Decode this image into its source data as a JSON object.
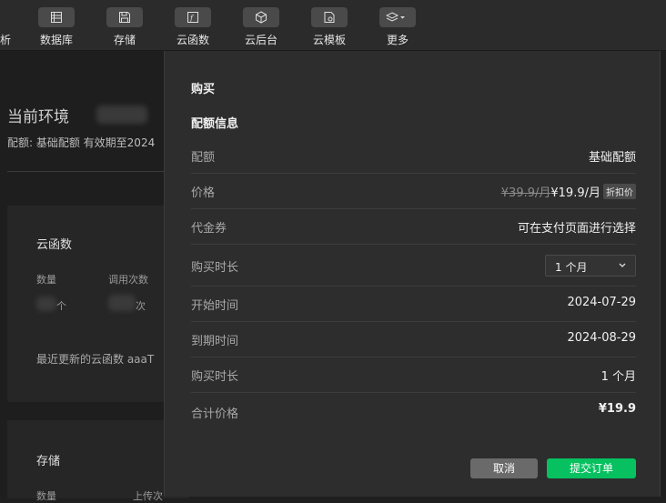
{
  "toolbar": {
    "partial_label": "析",
    "items": [
      {
        "label": "数据库",
        "icon": "database-icon"
      },
      {
        "label": "存储",
        "icon": "save-icon"
      },
      {
        "label": "云函数",
        "icon": "function-icon"
      },
      {
        "label": "云后台",
        "icon": "cube-icon"
      },
      {
        "label": "云模板",
        "icon": "template-icon"
      },
      {
        "label": "更多",
        "icon": "layers-icon"
      }
    ]
  },
  "background": {
    "env_title": "当前环境",
    "env_quota": "配额: 基础配额  有效期至2024",
    "functions_card": {
      "title": "云函数",
      "count_label": "数量",
      "calls_label": "调用次数",
      "count_unit": "个",
      "calls_unit": "次",
      "recent_text": "最近更新的云函数  aaaT"
    },
    "storage_card": {
      "title": "存储",
      "count_label": "数量",
      "upload_label": "上传次"
    }
  },
  "modal": {
    "title": "购买",
    "section": "配额信息",
    "rows": {
      "quota": {
        "label": "配额",
        "value": "基础配额"
      },
      "price": {
        "label": "价格",
        "original": "¥39.9/月",
        "current": "¥19.9/月",
        "badge": "折扣价"
      },
      "voucher": {
        "label": "代金券",
        "value": "可在支付页面进行选择"
      },
      "duration_select": {
        "label": "购买时长",
        "value": "1 个月"
      },
      "start": {
        "label": "开始时间",
        "value": "2024-07-29"
      },
      "end": {
        "label": "到期时间",
        "value": "2024-08-29"
      },
      "duration": {
        "label": "购买时长",
        "value": "1 个月"
      },
      "total": {
        "label": "合计价格",
        "value": "¥19.9"
      }
    },
    "cancel_label": "取消",
    "submit_label": "提交订单"
  },
  "colors": {
    "submit": "#07c160",
    "cancel": "#6a6a6a"
  }
}
